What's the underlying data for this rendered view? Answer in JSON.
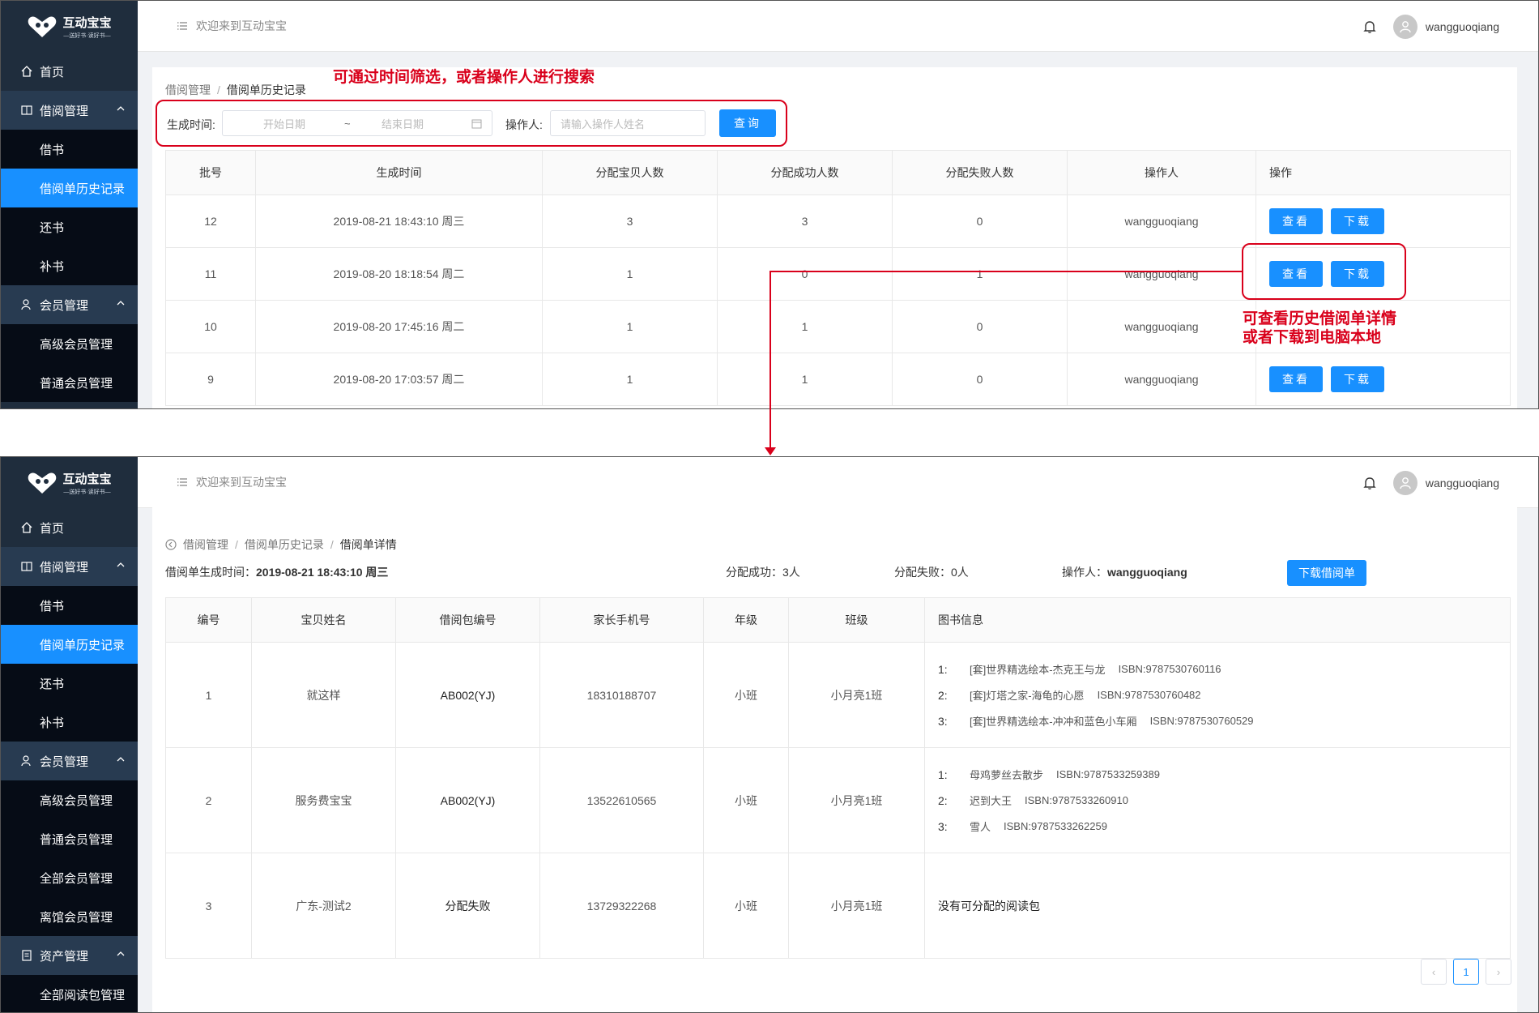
{
  "brand": {
    "title": "互动宝宝",
    "subtitle": "—送好书·读好书—"
  },
  "header": {
    "welcome": "欢迎来到互动宝宝",
    "username": "wangguoqiang"
  },
  "sidebar": {
    "home": "首页",
    "borrow_group": "借阅管理",
    "borrow_items": [
      "借书",
      "借阅单历史记录",
      "还书",
      "补书"
    ],
    "member_group": "会员管理",
    "member_items": [
      "高级会员管理",
      "普通会员管理",
      "全部会员管理",
      "离馆会员管理"
    ],
    "asset_group": "资产管理",
    "asset_items": [
      "全部阅读包管理"
    ]
  },
  "screen1": {
    "breadcrumb": [
      "借阅管理",
      "借阅单历史记录"
    ],
    "filter": {
      "time_label": "生成时间:",
      "start_placeholder": "开始日期",
      "range_sep": "~",
      "end_placeholder": "结束日期",
      "operator_label": "操作人:",
      "operator_placeholder": "请输入操作人姓名",
      "query_label": "查询"
    },
    "columns": [
      "批号",
      "生成时间",
      "分配宝贝人数",
      "分配成功人数",
      "分配失败人数",
      "操作人",
      "操作"
    ],
    "rows": [
      {
        "batch": "12",
        "time": "2019-08-21 18:43:10 周三",
        "total": "3",
        "success": "3",
        "fail": "0",
        "operator": "wangguoqiang"
      },
      {
        "batch": "11",
        "time": "2019-08-20 18:18:54 周二",
        "total": "1",
        "success": "0",
        "fail": "1",
        "operator": "wangguoqiang"
      },
      {
        "batch": "10",
        "time": "2019-08-20 17:45:16 周二",
        "total": "1",
        "success": "1",
        "fail": "0",
        "operator": "wangguoqiang"
      },
      {
        "batch": "9",
        "time": "2019-08-20 17:03:57 周二",
        "total": "1",
        "success": "1",
        "fail": "0",
        "operator": "wangguoqiang"
      }
    ],
    "view_label": "查看",
    "download_label": "下载",
    "annotation_search": "可通过时间筛选，或者操作人进行搜索",
    "annotation_detail": "可查看历史借阅单详情\n或者下载到电脑本地"
  },
  "screen2": {
    "breadcrumb": [
      "借阅管理",
      "借阅单历史记录",
      "借阅单详情"
    ],
    "meta": {
      "time_label": "借阅单生成时间：",
      "time_value": "2019-08-21 18:43:10 周三",
      "success_label": "分配成功：",
      "success_value": "3人",
      "fail_label": "分配失败：",
      "fail_value": "0人",
      "operator_label": "操作人：",
      "operator_value": "wangguoqiang",
      "download_label": "下载借阅单"
    },
    "columns": [
      "编号",
      "宝贝姓名",
      "借阅包编号",
      "家长手机号",
      "年级",
      "班级",
      "图书信息"
    ],
    "rows": [
      {
        "no": "1",
        "name": "就这样",
        "pack": "AB002(YJ)",
        "phone": "18310188707",
        "grade": "小班",
        "class": "小月亮1班",
        "books": [
          {
            "n": "1:",
            "title": "[套]世界精选绘本-杰克王与龙",
            "isbn": "ISBN:9787530760116"
          },
          {
            "n": "2:",
            "title": "[套]灯塔之家-海龟的心愿",
            "isbn": "ISBN:9787530760482"
          },
          {
            "n": "3:",
            "title": "[套]世界精选绘本-冲冲和蓝色小车厢",
            "isbn": "ISBN:9787530760529"
          }
        ],
        "note": ""
      },
      {
        "no": "2",
        "name": "服务费宝宝",
        "pack": "AB002(YJ)",
        "phone": "13522610565",
        "grade": "小班",
        "class": "小月亮1班",
        "books": [
          {
            "n": "1:",
            "title": "母鸡萝丝去散步",
            "isbn": "ISBN:9787533259389"
          },
          {
            "n": "2:",
            "title": "迟到大王",
            "isbn": "ISBN:9787533260910"
          },
          {
            "n": "3:",
            "title": "雪人",
            "isbn": "ISBN:9787533262259"
          }
        ],
        "note": ""
      },
      {
        "no": "3",
        "name": "广东-测试2",
        "pack": "分配失败",
        "phone": "13729322268",
        "grade": "小班",
        "class": "小月亮1班",
        "books": [],
        "note": "没有可分配的阅读包"
      }
    ],
    "pagination": {
      "prev": "‹",
      "current": "1",
      "next": "›"
    }
  }
}
